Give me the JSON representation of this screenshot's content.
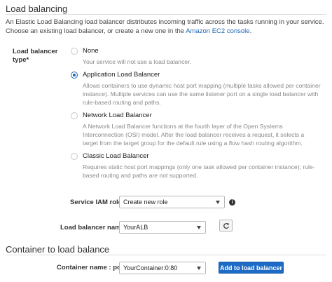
{
  "load_balancing": {
    "heading": "Load balancing",
    "intro_text": "An Elastic Load Balancing load balancer distributes incoming traffic across the tasks running in your service. Choose an existing load balancer, or create a new one in the",
    "intro_link": "Amazon EC2 console",
    "intro_end": ".",
    "type_label_line1": "Load balancer",
    "type_label_line2": "type*",
    "options": [
      {
        "label": "None",
        "description": "Your service will not use a load balancer.",
        "selected": false
      },
      {
        "label": "Application Load Balancer",
        "description": "Allows containers to use dynamic host port mapping (multiple tasks allowed per container instance). Multiple services can use the same listener port on a single load balancer with rule-based routing and paths.",
        "selected": true
      },
      {
        "label": "Network Load Balancer",
        "description": "A Network Load Balancer functions at the fourth layer of the Open Systems Interconnection (OSI) model. After the load balancer receives a request, it selects a target from the target group for the default rule using a flow hash routing algorithm.",
        "selected": false
      },
      {
        "label": "Classic Load Balancer",
        "description": "Requires static host port mappings (only one task allowed per container instance); rule-based routing and paths are not supported.",
        "selected": false
      }
    ],
    "iam_role_label": "Service IAM role",
    "iam_role_value": "Create new role",
    "lb_name_label": "Load balancer name",
    "lb_name_value": "YourALB"
  },
  "container_section": {
    "heading": "Container to load balance",
    "container_label": "Container name : port",
    "container_value": "YourContainer:0:80",
    "add_button": "Add to load balancer"
  },
  "colors": {
    "accent": "#1f66b3",
    "button": "#1e6bc6"
  },
  "icons": {
    "info": "info-icon",
    "refresh": "refresh-icon",
    "dropdown": "chevron-down-icon"
  }
}
